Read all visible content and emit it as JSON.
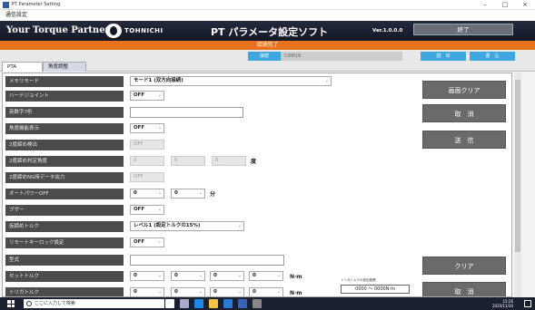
{
  "window": {
    "title": "PT Parameter Setting",
    "controls": [
      "–",
      "□",
      "×"
    ]
  },
  "menu": {
    "item": "通信設定"
  },
  "header": {
    "brand": "Your Torque Partner",
    "company": "TOHNICHI",
    "app_title": "PT パラメータ設定ソフト",
    "version": "Ver.1.0.0.0",
    "exit_label": "終了"
  },
  "status": {
    "text": "接続完了"
  },
  "connection": {
    "label": "接続",
    "port": "COM19"
  },
  "top_buttons": {
    "read": "読　出",
    "write": "書　込"
  },
  "tabs": [
    {
      "label": "PTA"
    },
    {
      "label": "角度調整"
    }
  ],
  "fields": {
    "memory_mode": {
      "label": "メモリモード",
      "value": "モード1 (双方向接続)"
    },
    "hard_joint": {
      "label": "ハードジョイント",
      "value": "OFF"
    },
    "alnum7": {
      "label": "英数字7桁",
      "value": ""
    },
    "angle_display": {
      "label": "角度機能表示",
      "value": "OFF"
    },
    "double_detect": {
      "label": "2度締め検出",
      "value": "OFF"
    },
    "double_angle": {
      "label": "2度締め判定角度",
      "v1": "0",
      "v2": "0",
      "v3": "0",
      "unit": "度"
    },
    "double_ng_output": {
      "label": "2度締めNG時データ出力",
      "value": "OFF"
    },
    "auto_power_off": {
      "label": "オートパワーOFF",
      "v1": "0",
      "v2": "0",
      "unit": "分"
    },
    "buzzer": {
      "label": "ブザー",
      "value": "OFF"
    },
    "pre_tighten_torque": {
      "label": "仮締めトルク",
      "value": "レベル1 (設定トルクの15%)"
    },
    "remote_key_lock": {
      "label": "リモートキーロック設定",
      "value": "OFF"
    },
    "model": {
      "label": "型式",
      "value": ""
    },
    "set_torque": {
      "label": "セットトルク",
      "v1": "0",
      "v2": "0",
      "v3": "0",
      "v4": "0",
      "unit": "N·m"
    },
    "trigger_torque": {
      "label": "トリガトルク",
      "v1": "0",
      "v2": "0",
      "v3": "0",
      "v4": "0",
      "unit": "N·m"
    }
  },
  "side_buttons": {
    "clear_screen": "画面クリア",
    "cancel": "取　消",
    "send": "送　信",
    "clear": "クリア",
    "cancel2": "取　消"
  },
  "range": {
    "title": "トリガトルクの設定範囲",
    "value": "0000 ～ 0000N·m"
  },
  "taskbar": {
    "search_placeholder": "ここに入力して検索",
    "time": "15:26",
    "date": "2020/11/30"
  },
  "colors": {
    "status": "#e8721c",
    "accent": "#3fa7e0",
    "banner": "#141826",
    "label_bg": "#4c4c4c"
  }
}
